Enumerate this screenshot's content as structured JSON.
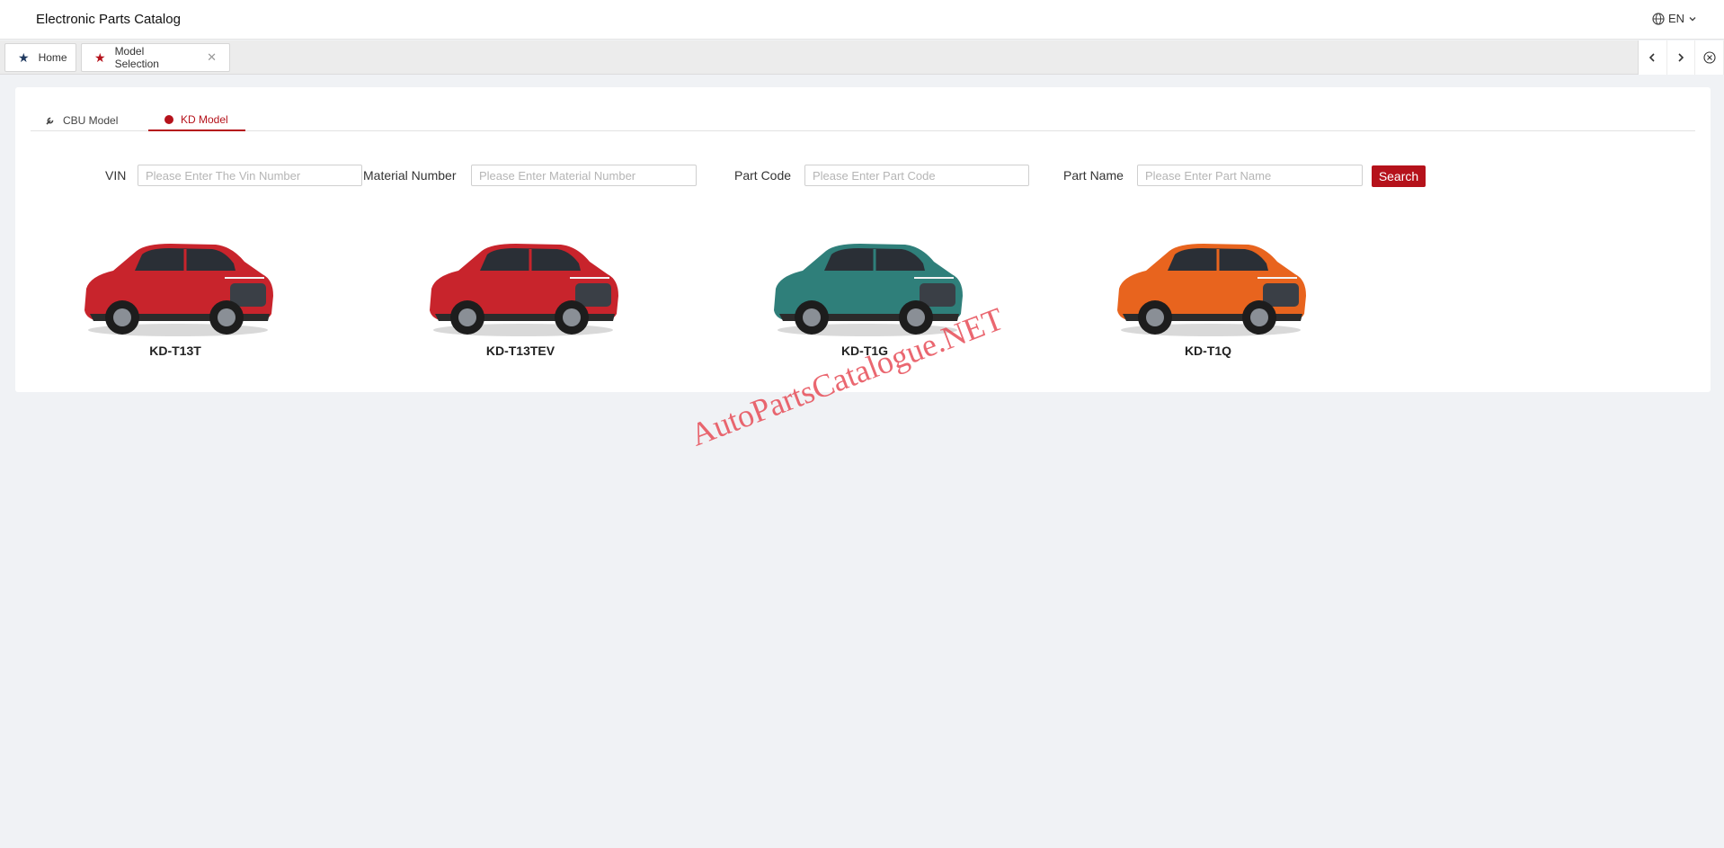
{
  "header": {
    "app_title": "Electronic Parts Catalog",
    "language": "EN",
    "language_icon": "globe-icon"
  },
  "tabs": [
    {
      "label": "Home",
      "icon": "star-icon",
      "icon_color": "#203a60"
    },
    {
      "label": "Model Selection",
      "icon": "star-icon",
      "icon_color": "#b5121b",
      "close_icon": "close-icon"
    }
  ],
  "tab_nav": {
    "prev_icon": "chevron-left-icon",
    "next_icon": "chevron-right-icon",
    "close_all_icon": "circle-close-icon"
  },
  "model_tabs": [
    {
      "label": "CBU Model",
      "icon": "wrench-icon",
      "active": false
    },
    {
      "label": "KD Model",
      "icon": "dot-icon",
      "active": true
    }
  ],
  "search": {
    "vin_label": "VIN",
    "vin_placeholder": "Please Enter The Vin Number",
    "material_label": "Material Number",
    "material_placeholder": "Please Enter Material Number",
    "part_code_label": "Part Code",
    "part_code_placeholder": "Please Enter Part Code",
    "part_name_label": "Part Name",
    "part_name_placeholder": "Please Enter Part Name",
    "search_label": "Search"
  },
  "models": [
    {
      "name": "KD-T13T",
      "color": "#c8242c"
    },
    {
      "name": "KD-T13TEV",
      "color": "#c8242c"
    },
    {
      "name": "KD-T1G",
      "color": "#2f7f7a"
    },
    {
      "name": "KD-T1Q",
      "color": "#e8641e"
    }
  ],
  "watermark": "AutoPartsCatalogue.NET",
  "colors": {
    "accent": "#b5121b",
    "background": "#f0f2f5"
  }
}
